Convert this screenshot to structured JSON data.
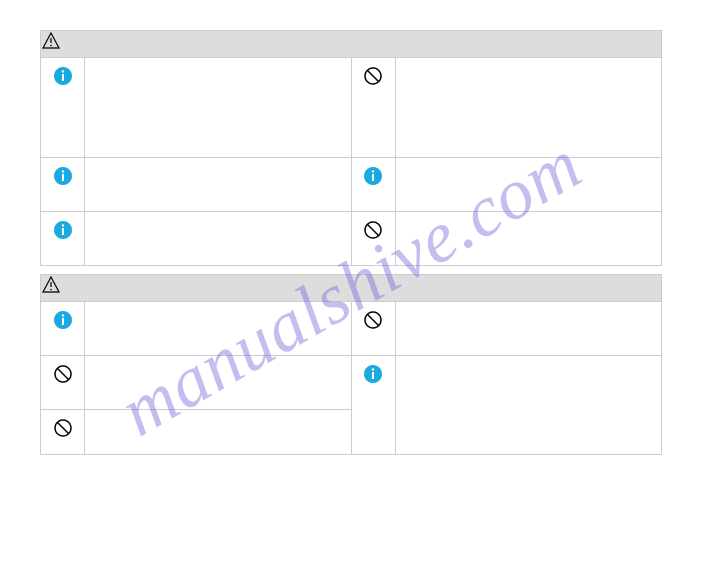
{
  "watermark": "manualshive.com",
  "tables": [
    {
      "header_icon": "warning-triangle",
      "rows": [
        {
          "left_icon": "info",
          "left_text": "",
          "right_icon": "prohibit",
          "right_text": "",
          "height": "tall"
        },
        {
          "left_icon": "info",
          "left_text": "",
          "right_icon": "info",
          "right_text": "",
          "height": "med"
        },
        {
          "left_icon": "info",
          "left_text": "",
          "right_icon": "prohibit",
          "right_text": "",
          "height": "med"
        }
      ]
    },
    {
      "header_icon": "warning-triangle",
      "rows": [
        {
          "left_icon": "info",
          "left_text": "",
          "right_icon": "prohibit",
          "right_text": "",
          "height": "med"
        },
        {
          "left_icon": "prohibit",
          "left_text": "",
          "right_icon": "info",
          "right_text": "",
          "height": "med",
          "right_rowspan": 2
        },
        {
          "left_icon": "prohibit",
          "left_text": "",
          "height": "short"
        }
      ]
    }
  ]
}
